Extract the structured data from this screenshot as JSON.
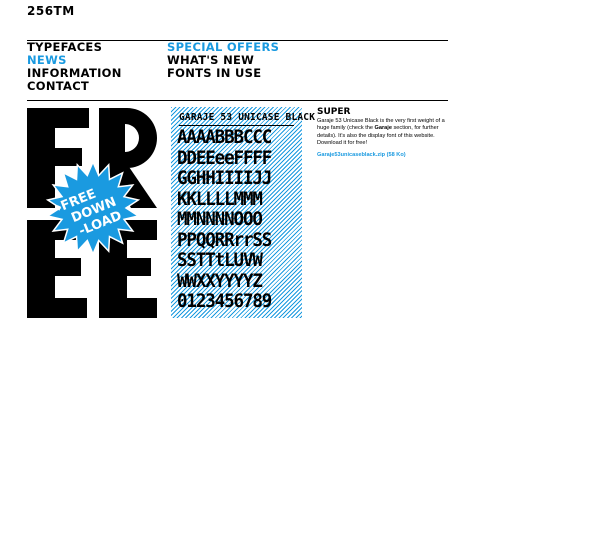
{
  "header": {
    "logo": "256TM"
  },
  "nav": {
    "col1": [
      "TYPEFACES",
      "NEWS",
      "INFORMATION",
      "CONTACT"
    ],
    "col2": [
      "SPECIAL OFFERS",
      "WHAT'S NEW",
      "FONTS IN USE"
    ],
    "active_color": "#1a9ae0"
  },
  "artwork": {
    "big_letters": [
      "F",
      "R",
      "E",
      "E"
    ],
    "badge_lines": [
      "→FREE",
      "DOWN",
      "-LOAD"
    ],
    "badge_color": "#1a9ae0"
  },
  "specimen": {
    "title": "GARAJE 53 UNICASE BLACK",
    "rows": [
      "AAAABBBCCC",
      "DDEEeeFFFF",
      "GGHHIIIIJJ",
      "KKLLLLMMM",
      "MMNNNNOOO",
      "PPQQRRrrSS",
      "SSTTtLUVW",
      "WWXXYYYYZ",
      "0123456789"
    ]
  },
  "info": {
    "title": "SUPER",
    "text_part1": "Garaje 53 Unicase Black is the very first weight of a huge family (check the ",
    "text_bold": "Garaje",
    "text_part2": " section, for further details). It’s also the display font of this website. Download it for free!",
    "link": "Garaje53unicaseblack.zip (58 Ko)",
    "link_color": "#1a9ae0"
  }
}
